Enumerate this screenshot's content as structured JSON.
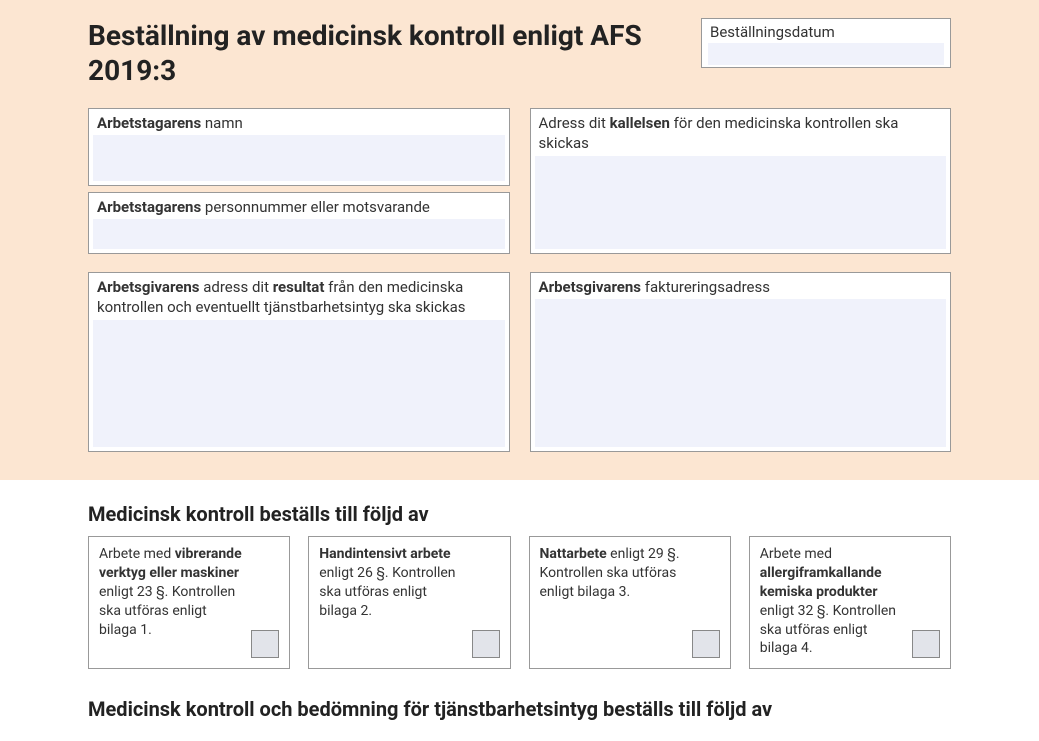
{
  "header": {
    "title": "Beställning av medicinsk kontroll enligt AFS 2019:3",
    "order_date_label": "Beställningsdatum"
  },
  "top_fields": {
    "employee_name_label_bold": "Arbetstagarens",
    "employee_name_label_rest": " namn",
    "employee_pnr_label_bold": "Arbetstagarens",
    "employee_pnr_label_rest": " personnummer eller motsvarande",
    "address_label_pre": "Adress dit ",
    "address_label_bold": "kallelsen",
    "address_label_post": " för den medicinska kontrollen ska skickas"
  },
  "employer_fields": {
    "result_label_b1": "Arbetsgivarens",
    "result_label_mid": " adress dit ",
    "result_label_b2": "resultat",
    "result_label_post": " från den medicinska kontrollen och eventuellt tjänstbarhetsintyg ska skickas",
    "billing_label_bold": "Arbetsgivarens",
    "billing_label_rest": " faktureringsadress"
  },
  "section1": {
    "heading": "Medicinsk kontroll beställs till följd av",
    "cards": [
      {
        "pre": "Arbete med ",
        "bold": "vibrerande verktyg eller maskiner",
        "post": " enligt 23 §. Kontrollen ska utföras enligt bilaga 1."
      },
      {
        "pre": "",
        "bold": "Handintensivt arbete",
        "post": " enligt 26 §. Kontrollen ska utföras enligt bilaga 2."
      },
      {
        "pre": "",
        "bold": "Nattarbete",
        "post": " enligt 29 §. Kontrollen ska utföras enligt bilaga 3."
      },
      {
        "pre": "Arbete med ",
        "bold": "allergiframkallande kemiska produkter",
        "post": " enligt 32 §. Kontrollen ska utföras enligt bilaga 4."
      }
    ]
  },
  "section2": {
    "heading": "Medicinsk kontroll och bedömning för tjänstbarhetsintyg beställs till följd av"
  }
}
